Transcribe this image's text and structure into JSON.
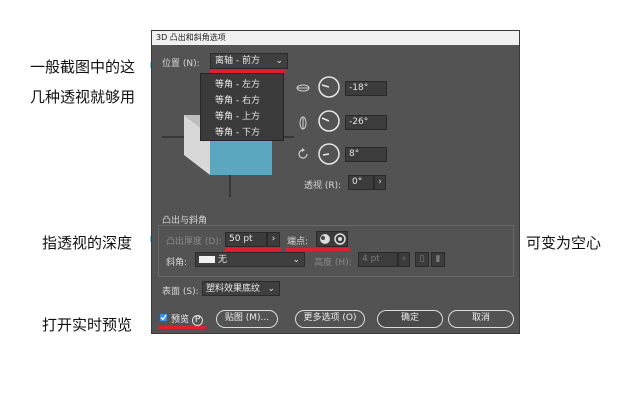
{
  "annotations": {
    "line1": "一般截图中的这",
    "line2": "几种透视就够用",
    "depth": "指透视的深度",
    "hollow": "可变为空心",
    "preview": "打开实时预览"
  },
  "dialog": {
    "title": "3D 凸出和斜角选项",
    "position_label": "位置 (N):",
    "position_value": "离轴 - 前方",
    "position_options": [
      "等角 - 左方",
      "等角 - 右方",
      "等角 - 上方",
      "等角 - 下方"
    ],
    "rotation": {
      "x": "-18°",
      "y": "-26°",
      "z": "8°"
    },
    "perspective_label": "透视 (R):",
    "perspective_value": "0°",
    "extrude_section": "凸出与斜角",
    "extrude_depth_label": "凸出厚度 (D):",
    "extrude_depth_value": "50 pt",
    "cap_label": "端点:",
    "bevel_label": "斜角:",
    "bevel_value": "无",
    "height_label": "高度 (H):",
    "height_value": "4 pt",
    "surface_label": "表面 (S):",
    "surface_value": "塑料效果底纹",
    "preview_label": "预览",
    "preview_key": "P",
    "buttons": {
      "map": "贴图 (M)...",
      "more": "更多选项 (O)",
      "ok": "确定",
      "cancel": "取消"
    }
  },
  "colors": {
    "arrow": "#59e3ea",
    "underline": "#e0202a",
    "cube_face": "#5ba7bf"
  }
}
